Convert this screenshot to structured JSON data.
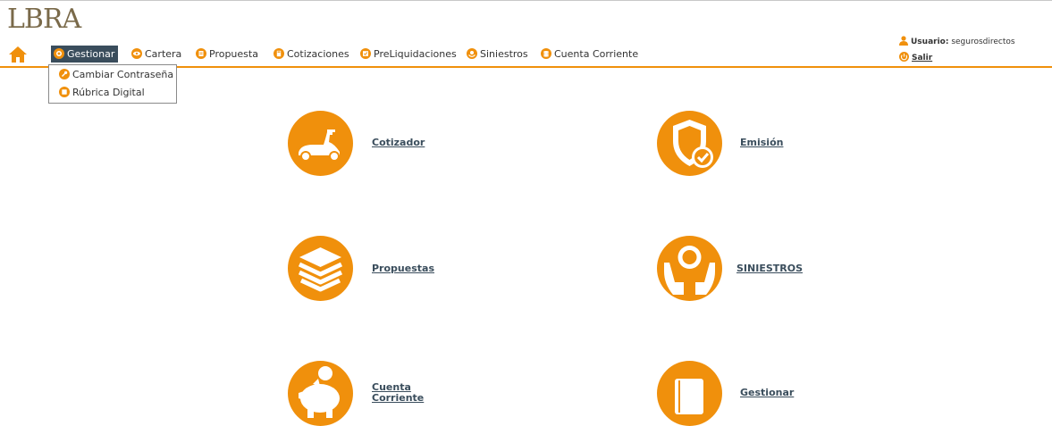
{
  "logo": {
    "text": "LBRA"
  },
  "nav": {
    "items": [
      {
        "label": "Gestionar",
        "icon": "gear-icon"
      },
      {
        "label": "Cartera",
        "icon": "eye-icon"
      },
      {
        "label": "Propuesta",
        "icon": "document-icon"
      },
      {
        "label": "Cotizaciones",
        "icon": "calculator-icon"
      },
      {
        "label": "PreLiquidaciones",
        "icon": "invoice-icon"
      },
      {
        "label": "Siniestros",
        "icon": "lifebuoy-icon"
      },
      {
        "label": "Cuenta Corriente",
        "icon": "coins-icon"
      }
    ],
    "dropdown": [
      {
        "label": "Cambiar Contraseña",
        "icon": "wrench-icon"
      },
      {
        "label": "Rúbrica Digital",
        "icon": "signature-icon"
      }
    ]
  },
  "user": {
    "label": "Usuario:",
    "name": "segurosdirectos",
    "logout": "Salir"
  },
  "tiles": [
    {
      "label": "Cotizador",
      "icon": "scooter-icon"
    },
    {
      "label": "Emisión",
      "icon": "shield-check-icon"
    },
    {
      "label": "Propuestas",
      "icon": "stack-icon"
    },
    {
      "label": "SINIESTROS",
      "icon": "hands-person-icon"
    },
    {
      "label": "Cuenta Corriente",
      "icon": "piggy-bank-icon"
    },
    {
      "label": "Gestionar",
      "icon": "book-icon"
    }
  ],
  "colors": {
    "accent": "#f0900c",
    "nav_active": "#3a4d5c",
    "link": "#3a4d5c"
  }
}
